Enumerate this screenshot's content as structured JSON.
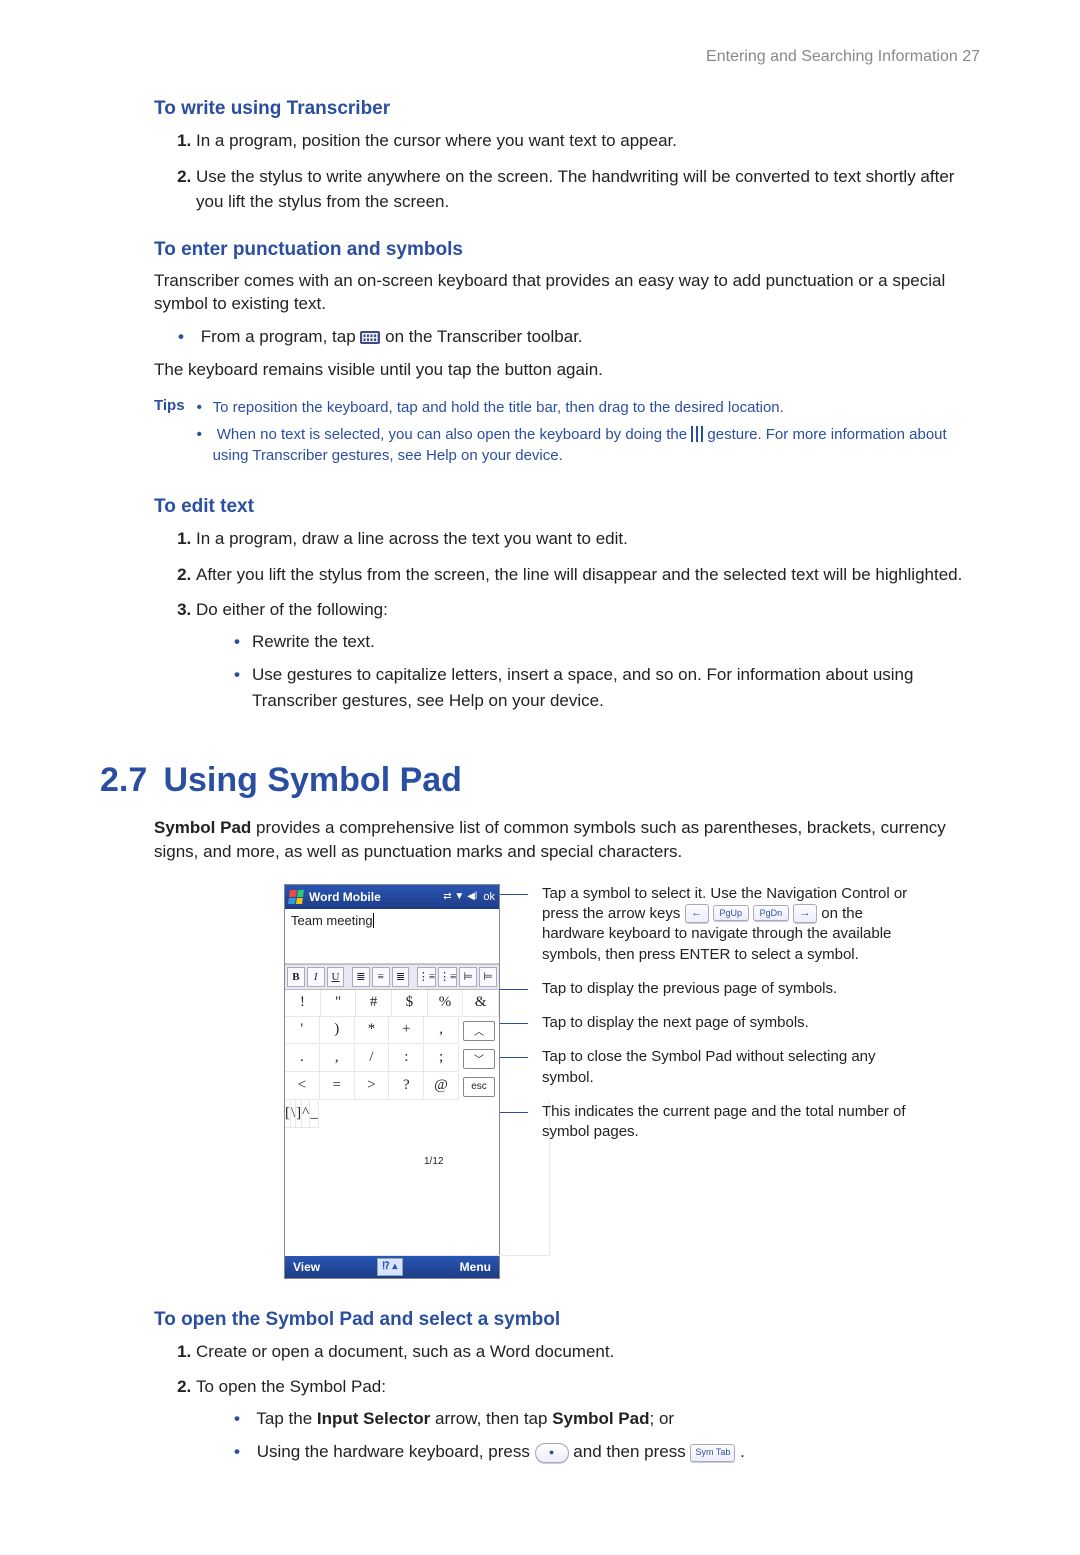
{
  "header": {
    "running_head": "Entering and Searching Information  27"
  },
  "s1": {
    "h": "To write using Transcriber",
    "li1": "In a program, position the cursor where you want text to appear.",
    "li2": "Use the stylus to write anywhere on the screen. The handwriting will be converted to text shortly after you lift the stylus from the screen."
  },
  "s2": {
    "h": "To enter punctuation and symbols",
    "p1": "Transcriber comes with an on-screen keyboard that provides an easy way to add punctuation or a special symbol to existing text.",
    "bul1a": "From a program, tap ",
    "bul1b": " on the Transcriber toolbar.",
    "p2": "The keyboard remains visible until you tap the button again."
  },
  "tips": {
    "label": "Tips",
    "t1": "To reposition the keyboard, tap and hold the title bar, then drag to the desired location.",
    "t2a": "When no text is selected, you can also open the keyboard by doing the ",
    "t2b": " gesture. For more information about using Transcriber gestures, see Help on your device."
  },
  "s3": {
    "h": "To edit text",
    "li1": "In a program, draw a line across the text you want to edit.",
    "li2": "After you lift the stylus from the screen, the line will disappear and the selected text will be highlighted.",
    "li3": "Do either of the following:",
    "sub1": "Rewrite the text.",
    "sub2": "Use gestures to capitalize letters, insert a space, and so on. For information about using Transcriber gestures, see Help on your device."
  },
  "sec27": {
    "num": "2.7",
    "title": "Using Symbol Pad",
    "intro_pre": "Symbol Pad",
    "intro_post": " provides a comprehensive list of common symbols such as parentheses, brackets, currency signs, and more, as well as punctuation marks and special characters."
  },
  "device": {
    "title": "Word Mobile",
    "ok": "ok",
    "doc_text": "Team meeting",
    "fmt": [
      "B",
      "I",
      "U",
      "",
      "≣",
      "≡",
      "≣",
      "",
      "⋮≡",
      "⋮≡",
      "⊨",
      "⊨"
    ],
    "rows": [
      [
        "!",
        "\"",
        "#",
        "$",
        "%",
        "&"
      ],
      [
        "'",
        ")",
        "*",
        "+",
        ",",
        "__UP__"
      ],
      [
        ".",
        ",",
        "/",
        ":",
        ";",
        "__DOWN__"
      ],
      [
        "<",
        "=",
        ">",
        "?",
        "@",
        "esc"
      ],
      [
        "[",
        "\\",
        "]",
        "^",
        "_",
        "1/12"
      ]
    ],
    "view": "View",
    "menu": "Menu"
  },
  "callouts": {
    "c1a": "Tap a symbol to select it. Use the Navigation Control or press the arrow keys ",
    "c1b": " on the hardware keyboard to navigate through the available symbols, then press ENTER to select a symbol.",
    "keys": [
      "←",
      "PgUp",
      "PgDn",
      "→"
    ],
    "c2": "Tap to display the previous page of symbols.",
    "c3": "Tap to display the next page of symbols.",
    "c4": "Tap to close the Symbol Pad without selecting any symbol.",
    "c5": "This indicates the current page and the total number of symbol pages."
  },
  "s4": {
    "h": "To open the Symbol Pad and select a symbol",
    "li1": "Create or open a document, such as a Word document.",
    "li2": "To open the Symbol Pad:",
    "sub1a": "Tap the ",
    "sub1b": "Input Selector",
    "sub1c": " arrow, then tap ",
    "sub1d": "Symbol Pad",
    "sub1e": "; or",
    "sub2a": "Using the hardware keyboard, press ",
    "sub2b": " and then press ",
    "sub2c": " .",
    "key1": "●",
    "key2": "Sym Tab"
  }
}
